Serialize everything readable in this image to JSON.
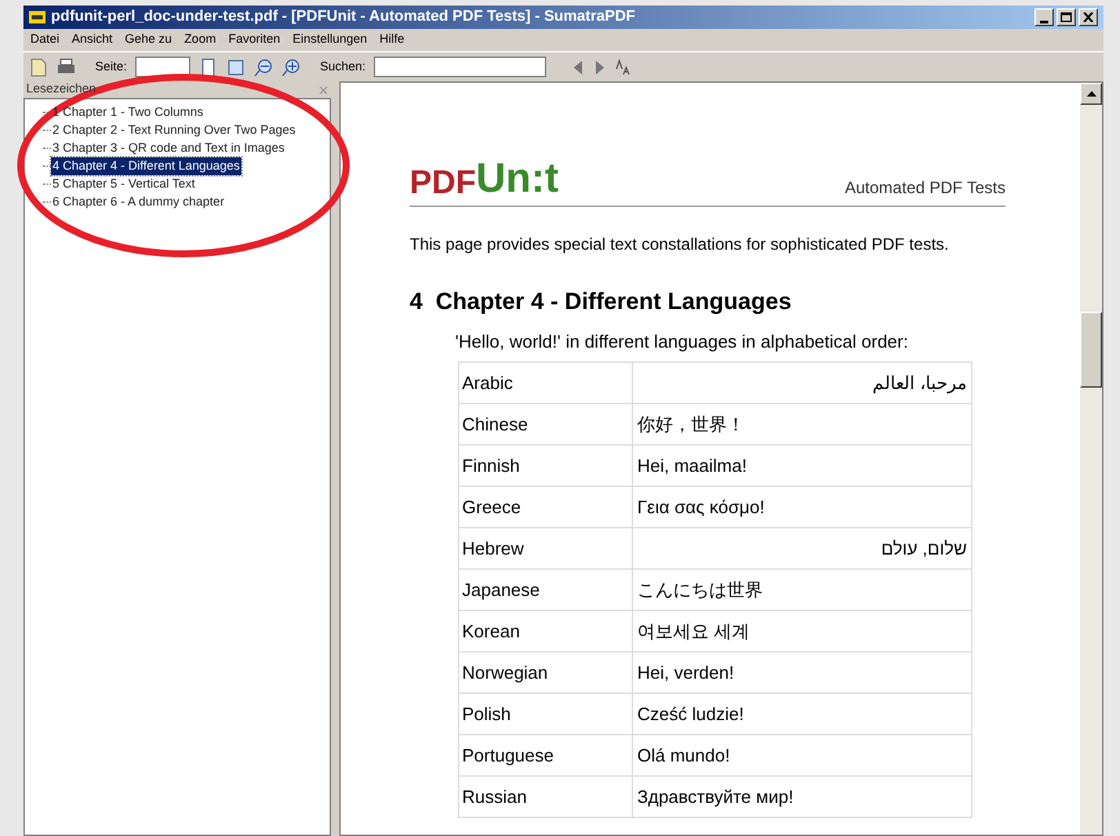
{
  "window": {
    "title": "pdfunit-perl_doc-under-test.pdf - [PDFUnit - Automated PDF Tests] - SumatraPDF"
  },
  "menu": [
    "Datei",
    "Ansicht",
    "Gehe zu",
    "Zoom",
    "Favoriten",
    "Einstellungen",
    "Hilfe"
  ],
  "toolbar": {
    "page_label": "Seite:",
    "search_label": "Suchen:"
  },
  "sidebar": {
    "title": "Lesezeichen",
    "items": [
      {
        "label": "1 Chapter 1 - Two Columns",
        "selected": false
      },
      {
        "label": "2 Chapter 2 - Text Running Over Two Pages",
        "selected": false
      },
      {
        "label": "3 Chapter 3 - QR code and Text in Images",
        "selected": false
      },
      {
        "label": "4 Chapter 4 - Different Languages",
        "selected": true
      },
      {
        "label": "5 Chapter 5 - Vertical Text",
        "selected": false
      },
      {
        "label": "6 Chapter 6 - A dummy chapter",
        "selected": false
      }
    ]
  },
  "document": {
    "logo_pdf": "PDF",
    "logo_unit": "Un:t",
    "header_right": "Automated PDF Tests",
    "intro": "This page provides special text constallations for sophisticated PDF tests.",
    "heading": "4  Chapter 4 - Different Languages",
    "lead": "'Hello, world!' in different languages in alphabetical order:",
    "rows": [
      {
        "language": "Arabic",
        "text": "مرحبا، العالم",
        "rtl": true
      },
      {
        "language": "Chinese",
        "text": "你好，世界！",
        "rtl": false
      },
      {
        "language": "Finnish",
        "text": "Hei, maailma!",
        "rtl": false
      },
      {
        "language": "Greece",
        "text": "Γεια σας κόσμο!",
        "rtl": false
      },
      {
        "language": "Hebrew",
        "text": "שלום, עולם",
        "rtl": true
      },
      {
        "language": "Japanese",
        "text": "こんにちは世界",
        "rtl": false
      },
      {
        "language": "Korean",
        "text": "여보세요 세계",
        "rtl": false
      },
      {
        "language": "Norwegian",
        "text": "Hei, verden!",
        "rtl": false
      },
      {
        "language": "Polish",
        "text": "Cześć ludzie!",
        "rtl": false
      },
      {
        "language": "Portuguese",
        "text": "Olá mundo!",
        "rtl": false
      },
      {
        "language": "Russian",
        "text": "Здравствуйте мир!",
        "rtl": false
      }
    ]
  }
}
